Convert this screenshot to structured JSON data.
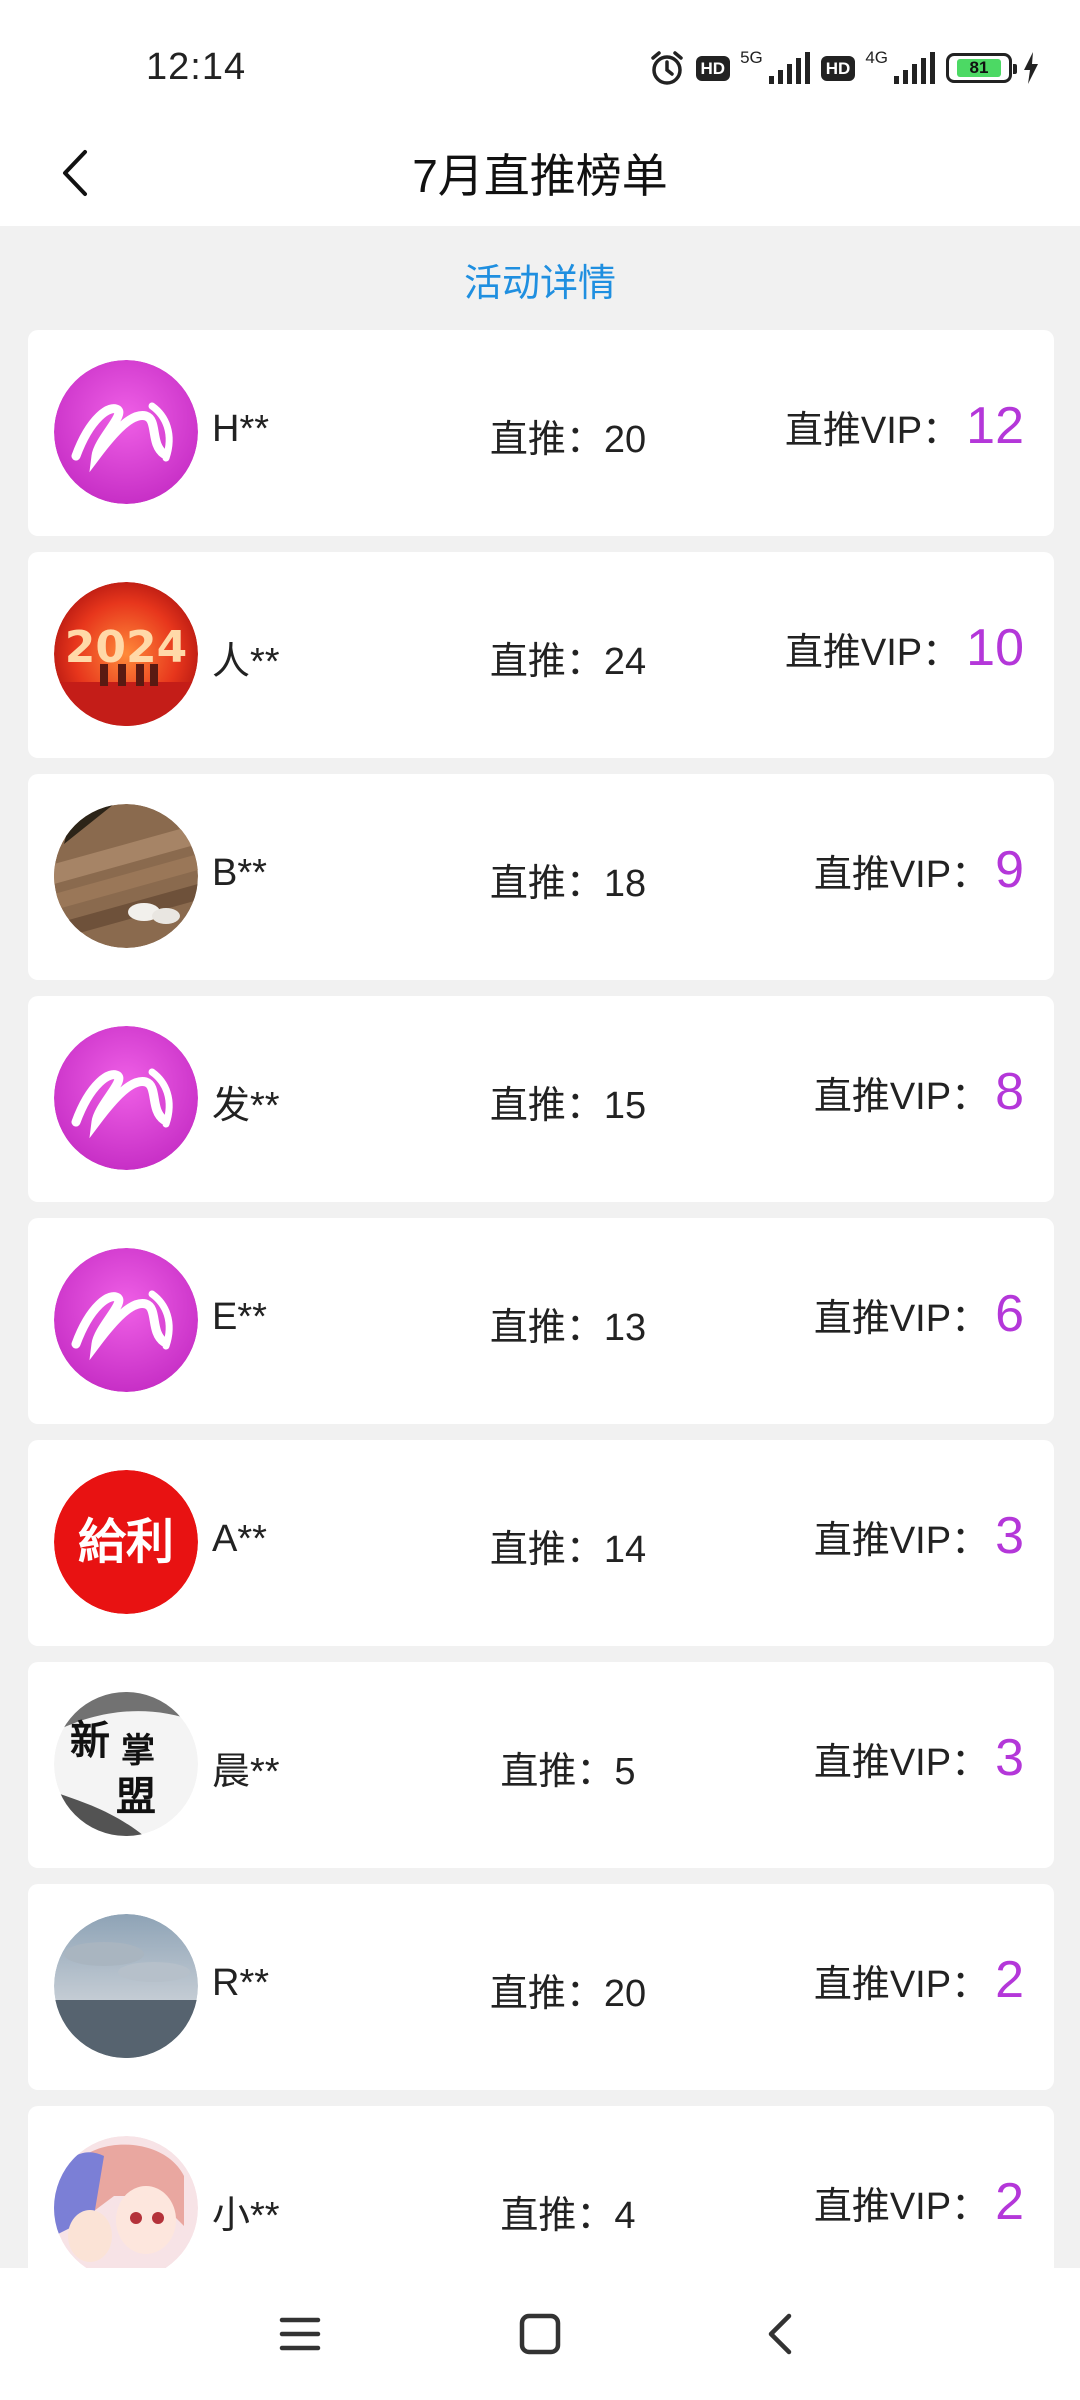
{
  "status_bar": {
    "time": "12:14",
    "hd1": "HD",
    "net1": "5G",
    "hd2": "HD",
    "net2": "4G",
    "battery": "81",
    "battery_level": 0.81
  },
  "header": {
    "title": "7月直推榜单"
  },
  "activity_link": "活动详情",
  "colors": {
    "accent_blue": "#1f8fe0",
    "vip_purple": "#b437d9",
    "background": "#f1f1f1"
  },
  "ranking": [
    {
      "name": "H**",
      "direct": "直推：20",
      "vip_label": "直推VIP：",
      "vip_value": "12",
      "avatar_icon": "pink-logo-avatar"
    },
    {
      "name": "人**",
      "direct": "直推：24",
      "vip_label": "直推VIP：",
      "vip_value": "10",
      "avatar_icon": "red-2024-avatar"
    },
    {
      "name": "B**",
      "direct": "直推：18",
      "vip_label": "直推VIP：",
      "vip_value": "9",
      "avatar_icon": "photo-deck-avatar"
    },
    {
      "name": "发**",
      "direct": "直推：15",
      "vip_label": "直推VIP：",
      "vip_value": "8",
      "avatar_icon": "pink-logo-avatar"
    },
    {
      "name": "E**",
      "direct": "直推：13",
      "vip_label": "直推VIP：",
      "vip_value": "6",
      "avatar_icon": "pink-logo-avatar"
    },
    {
      "name": "A**",
      "direct": "直推：14",
      "vip_label": "直推VIP：",
      "vip_value": "3",
      "avatar_icon": "red-calligraphy-avatar"
    },
    {
      "name": "晨**",
      "direct": "直推：5",
      "vip_label": "直推VIP：",
      "vip_value": "3",
      "avatar_icon": "ink-calligraphy-avatar"
    },
    {
      "name": "R**",
      "direct": "直推：20",
      "vip_label": "直推VIP：",
      "vip_value": "2",
      "avatar_icon": "sea-sky-avatar"
    },
    {
      "name": "小**",
      "direct": "直推：4",
      "vip_label": "直推VIP：",
      "vip_value": "2",
      "avatar_icon": "anime-avatar"
    }
  ],
  "avatar_text": {
    "red_2024": "2024",
    "red_calligraphy": "給利",
    "ink_calligraphy": [
      "新",
      "掌",
      "盟"
    ]
  },
  "nav_bar": {
    "menu_icon": "menu-icon",
    "home_icon": "home-square-icon",
    "back_icon": "back-chevron-icon"
  }
}
